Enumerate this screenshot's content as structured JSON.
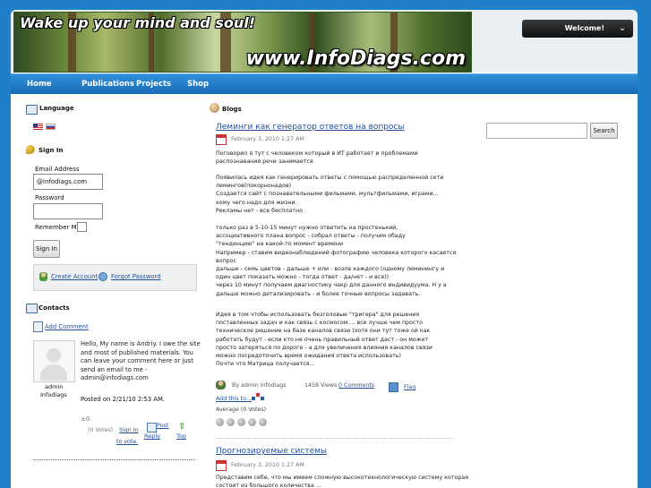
{
  "banner": {
    "tagline": "Wake up your mind and soul!",
    "site_name": "www.InfoDiags.com"
  },
  "header": {
    "welcome_label": "Welcome!",
    "welcome_arrow": "⌄"
  },
  "nav": {
    "items": [
      "Home",
      "Publications",
      "Projects",
      "Shop"
    ]
  },
  "language": {
    "title": "Language"
  },
  "signin": {
    "title": "Sign In",
    "email_label": "Email Address",
    "email_value": "@infodiags.com",
    "password_label": "Password",
    "remember_label": "Remember Me",
    "button": "Sign In",
    "create_account": "Create Account",
    "forgot_password": "Forgot Password"
  },
  "contacts": {
    "title": "Contacts",
    "add_comment": "Add Comment",
    "avatar_name": "admin",
    "avatar_site": "Infodiags",
    "message_lines": [
      "Hello, My name is Andriy. I owe the site",
      "and most of published materials. You",
      "can leave your comment here or just",
      "send an email to me -",
      "admin@infodiags.com"
    ],
    "posted": "Posted on 2/21/10 2:53 AM.",
    "score": "±0",
    "votes": "(0 Votes)",
    "sign_in": "Sign in",
    "to_vote": "to vote.",
    "post_reply_1": "Post",
    "post_reply_2": "Reply",
    "top": "Top"
  },
  "blogs": {
    "title": "Blogs"
  },
  "post1": {
    "title": "Леминги как генератор ответов на вопросы",
    "date": "February 3, 2010 1:27 AM",
    "p1": "Поговорил я тут с человеком который в ИТ работает и проблемами\nраспознавания речи занимается",
    "p2": "Появилась идея как генерировать ответы с помощью распределенной сети\nлемингов(покорнонадов)\nСоздается сайт с познавательными фильмами, мультфильмами, играми...\nкому чего надо для жизни.\nРекламы нет - все бесплатно",
    "p3": "только раз в 5-10-15 минут нужно ответить на простенький,\nассоциативного плана вопрос - собрал ответы - получим обаду\n\"тенденцию\" на какой-то момент времени\nНапример - ставим видеонаблюдений фотографию человека которого касается\nвопрос\nдальше - семь цветов - дальше + или - возле каждого (одному леминингу и\nодин цвет показать можно - тогда ответ - да/нет - и все))\nчерез 10 минут получаем диагностику чакр для данного индивидуума. Н у а\nдальше можно детализировать - и более точные вопросы задавать.",
    "p4": "Идея в том чтобы использовать безголовые \"тригера\" для решения\nпоставленных задач и как связь с космосом.... все лучше чем просто\nтехническое решение на базе каналов связи (хотя они тут тоже ой как\nработать будут - если кто не очень правильный ответ даст - он может\nпросто затеряться по дороге - а для увеличения влияния каналов связи\nможно посредоточить время ожидания ответа использовать)\nПочти что Матрица получается...",
    "by": "By admin Infodiags",
    "views": "1458 Views.",
    "comments": "0 Comments",
    "flag": "Flag",
    "add_this": "Add this to...",
    "average": "Average (0 Votes)"
  },
  "post2": {
    "title": "Прогнозируемые системы",
    "date": "February 3, 2010 1:27 AM",
    "p1": "Представим себе, что мы имеем сложную высокотехнологическую систему которая\nсостоит из большого количества ..."
  },
  "search": {
    "button": "Search"
  }
}
